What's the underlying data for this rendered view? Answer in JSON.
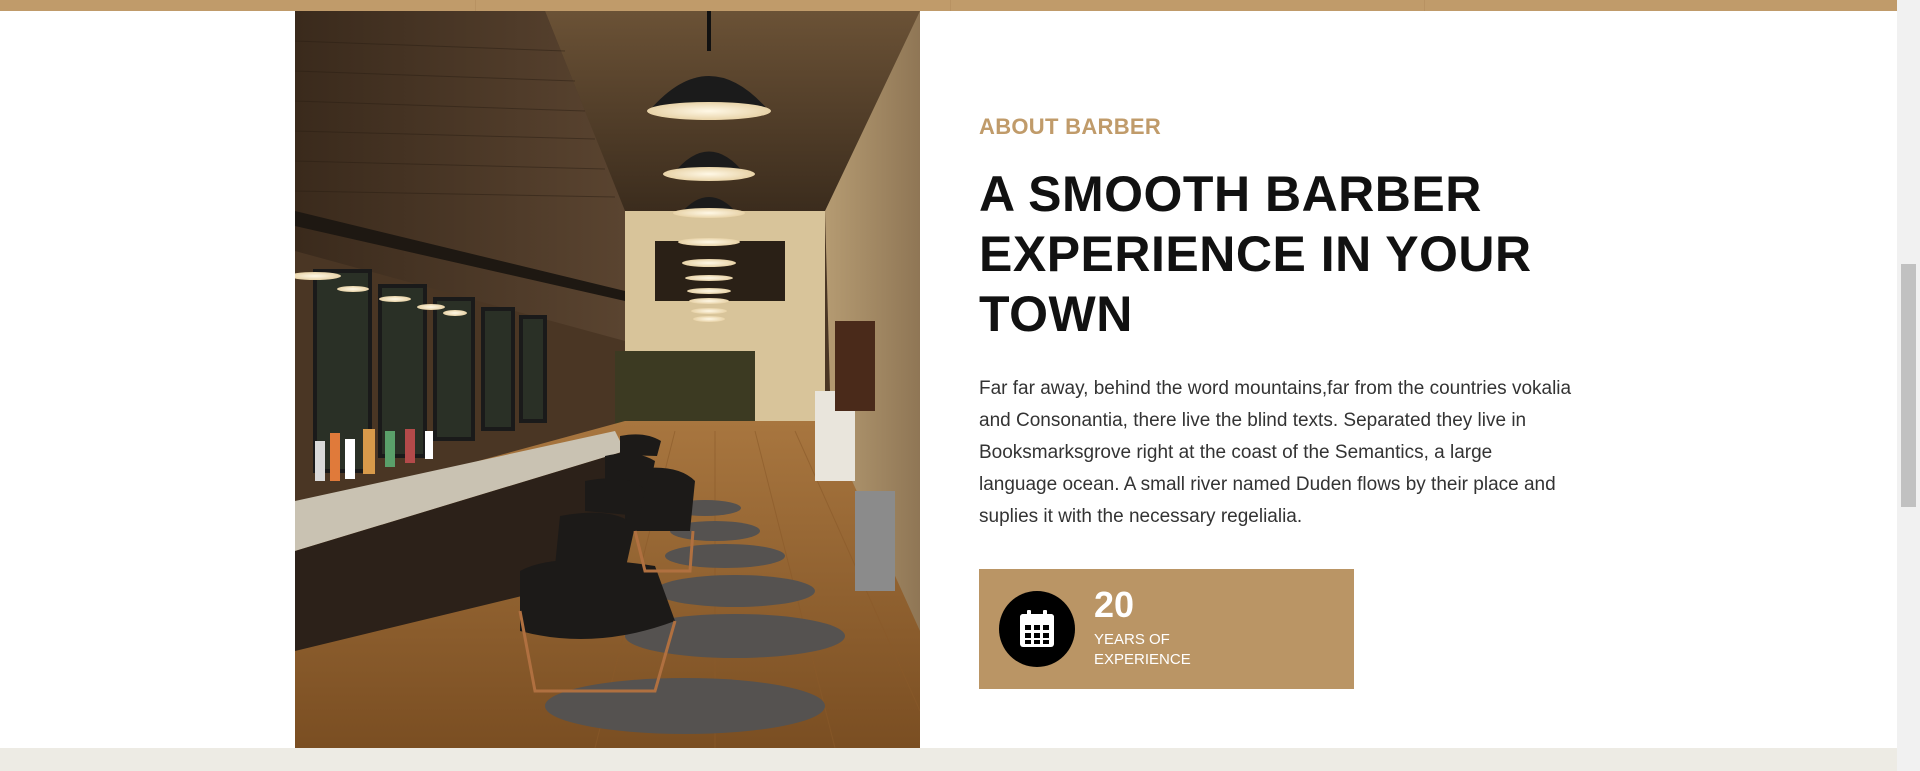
{
  "about": {
    "eyebrow": "ABOUT BARBER",
    "heading_lines": [
      "A SMOOTH BARBER",
      "EXPERIENCE IN YOUR",
      "TOWN"
    ],
    "body_lines": [
      "Far far away, behind the word mountains,far from the countries vokalia",
      "and Consonantia, there live the blind texts. Separated they live in",
      "Booksmarksgrove right at the coast of the Semantics, a large",
      "language ocean. A small river named Duden flows by their place and",
      "suplies it with the necessary regelialia."
    ]
  },
  "stat": {
    "number": "20",
    "label_lines": [
      "YEARS OF",
      "EXPERIENCE"
    ],
    "icon": "calendar-icon"
  },
  "colors": {
    "accent": "#c09b6a",
    "stat_bg": "#ba9565",
    "heading": "#111111",
    "body": "#333333",
    "footer_band": "#edebe4"
  },
  "image": {
    "subject": "barbershop-interior-photo"
  }
}
